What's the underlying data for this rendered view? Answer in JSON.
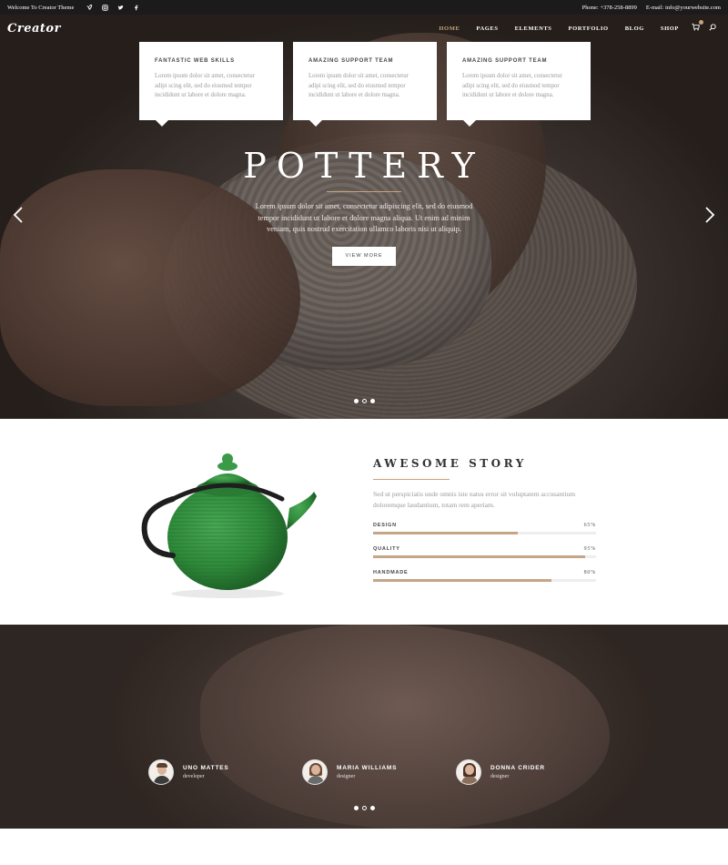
{
  "topbar": {
    "welcome": "Welcome To Creator Theme",
    "phone": "Phone: +378-258-8899",
    "email": "E-mail: info@yourwebsite.com",
    "social_icons": [
      "vimeo-icon",
      "instagram-icon",
      "twitter-icon",
      "facebook-icon"
    ]
  },
  "nav": {
    "logo": "Creator",
    "items": [
      "HOME",
      "PAGES",
      "ELEMENTS",
      "PORTFOLIO",
      "BLOG",
      "SHOP"
    ],
    "active": "HOME"
  },
  "hero": {
    "title": "POTTERY",
    "text": "Lorem ipsum dolor sit amet, consectetur adipiscing elit, sed do eiusmod tempor incididunt ut labore et dolore magna aliqua. Ut enim ad minim veniam, quis nostrud exercitation ullamco laboris nisi ut aliquip.",
    "button": "VIEW MORE",
    "slides": 3,
    "active_slide": 2
  },
  "story": {
    "title": "AWESOME STORY",
    "text": "Sed ut perspiciatis unde omnis iste natus error sit voluptatem accusantium doloremque laudantium, totam rem aperiam.",
    "skills": [
      {
        "label": "DESIGN",
        "percent_text": "65%",
        "value": 65
      },
      {
        "label": "QUALITY",
        "percent_text": "95%",
        "value": 95
      },
      {
        "label": "HANDMADE",
        "percent_text": "80%",
        "value": 80
      }
    ]
  },
  "testimonials": {
    "cards": [
      {
        "title": "FANTASTIC WEB SKILLS",
        "text": "Lorem ipsum dolor sit amet, consectetur adipi scing elit, sed do eiusmod tempor incididunt ut labore et dolore magna.",
        "name": "UNO MATTES",
        "role": "developer"
      },
      {
        "title": "AMAZING SUPPORT TEAM",
        "text": "Lorem ipsum dolor sit amet, consectetur adipi scing elit, sed do eiusmod tempor incididunt ut labore et dolore magna.",
        "name": "MARIA WILLIAMS",
        "role": "designer"
      },
      {
        "title": "AMAZING SUPPORT TEAM",
        "text": "Lorem ipsum dolor sit amet, consectetur adipi scing elit, sed do eiusmod tempor incididunt ut labore et dolore magna.",
        "name": "DONNA CRIDER",
        "role": "designer"
      }
    ],
    "slides": 3,
    "active_slide": 2
  },
  "colors": {
    "accent": "#c9a27c",
    "bar_fill": "#c4a586",
    "teapot_green": "#2f8a3a"
  }
}
